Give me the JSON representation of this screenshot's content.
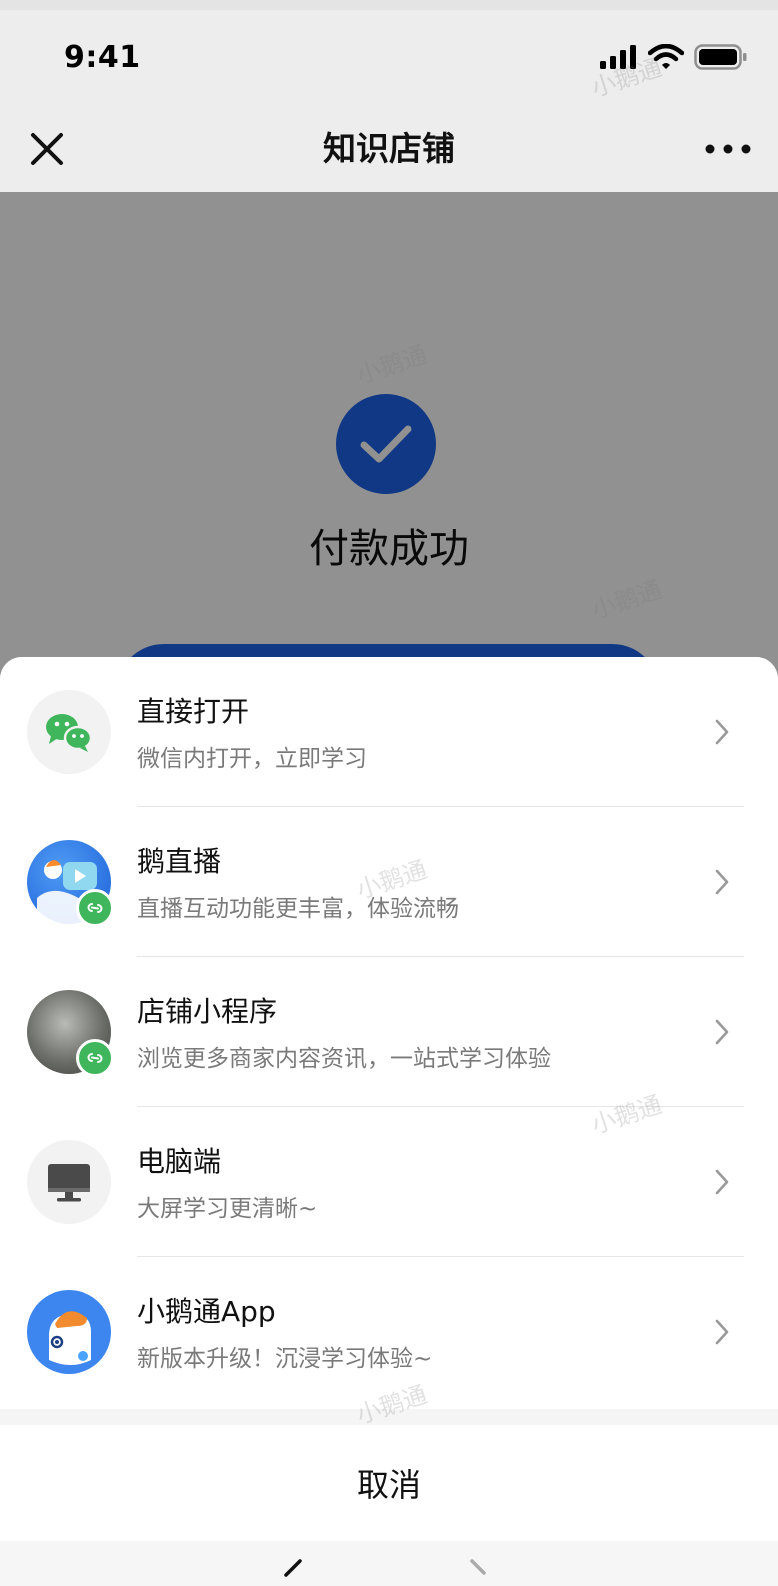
{
  "status_bar": {
    "time": "9:41"
  },
  "nav": {
    "title": "知识店铺"
  },
  "result": {
    "text": "付款成功"
  },
  "watermark": "小鹅通",
  "sheet": {
    "options": [
      {
        "title": "直接打开",
        "subtitle": "微信内打开，立即学习",
        "icon": "wechat-icon"
      },
      {
        "title": "鹅直播",
        "subtitle": "直播互动功能更丰富，体验流畅",
        "icon": "live-app-icon"
      },
      {
        "title": "店铺小程序",
        "subtitle": "浏览更多商家内容资讯，一站式学习体验",
        "icon": "mini-program-icon"
      },
      {
        "title": "电脑端",
        "subtitle": "大屏学习更清晰~",
        "icon": "desktop-icon"
      },
      {
        "title": "小鹅通App",
        "subtitle": "新版本升级！沉浸学习体验~",
        "icon": "xiaoe-app-icon"
      }
    ],
    "cancel_label": "取消"
  },
  "colors": {
    "accent": "#1e63e9",
    "wechat_green": "#3fb65b"
  }
}
